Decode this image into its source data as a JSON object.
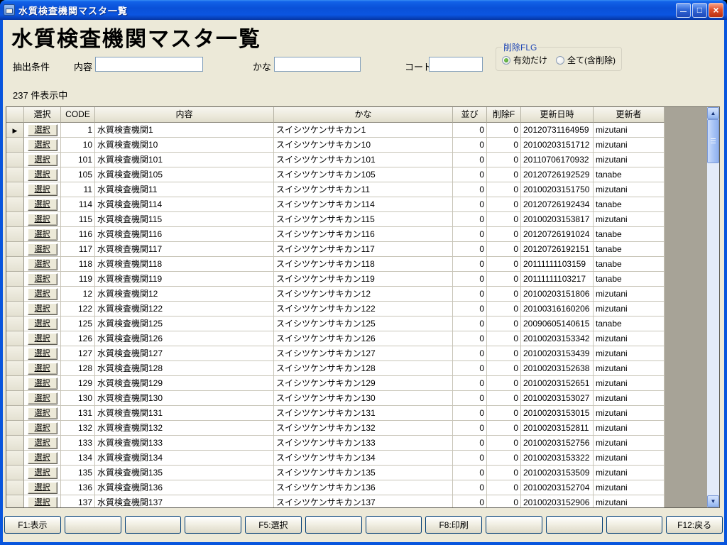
{
  "window": {
    "title": "水質検査機関マスタ一覧",
    "minimize_glyph": "—",
    "maximize_glyph": "□",
    "close_glyph": "×"
  },
  "page": {
    "heading": "水質検査機関マスタ一覧",
    "count_text": "237 件表示中"
  },
  "filters": {
    "section_label": "抽出条件",
    "naiyo": {
      "label": "内容",
      "value": ""
    },
    "kana": {
      "label": "かな",
      "value": ""
    },
    "code": {
      "label": "コード",
      "value": ""
    },
    "delete_flg": {
      "label": "削除FLG",
      "option_active": "有効だけ",
      "option_all": "全て(含削除)",
      "selected": "有効だけ"
    }
  },
  "grid": {
    "columns": {
      "selector": "",
      "select": "選択",
      "code": "CODE",
      "naiyo": "内容",
      "kana": "かな",
      "narabi": "並び",
      "sakujo_f": "削除F",
      "koshin_nichiji": "更新日時",
      "koshin_sha": "更新者"
    },
    "select_button_label": "選択",
    "current_row_marker": "▶",
    "rows": [
      {
        "code": "1",
        "naiyo": "水質検査機関1",
        "kana": "スイシツケンサキカン1",
        "narabi": "0",
        "sakujo_f": "0",
        "koshin_nichiji": "20120731164959",
        "koshin_sha": "mizutani"
      },
      {
        "code": "10",
        "naiyo": "水質検査機関10",
        "kana": "スイシツケンサキカン10",
        "narabi": "0",
        "sakujo_f": "0",
        "koshin_nichiji": "20100203151712",
        "koshin_sha": "mizutani"
      },
      {
        "code": "101",
        "naiyo": "水質検査機関101",
        "kana": "スイシツケンサキカン101",
        "narabi": "0",
        "sakujo_f": "0",
        "koshin_nichiji": "20110706170932",
        "koshin_sha": "mizutani"
      },
      {
        "code": "105",
        "naiyo": "水質検査機関105",
        "kana": "スイシツケンサキカン105",
        "narabi": "0",
        "sakujo_f": "0",
        "koshin_nichiji": "20120726192529",
        "koshin_sha": "tanabe"
      },
      {
        "code": "11",
        "naiyo": "水質検査機関11",
        "kana": "スイシツケンサキカン11",
        "narabi": "0",
        "sakujo_f": "0",
        "koshin_nichiji": "20100203151750",
        "koshin_sha": "mizutani"
      },
      {
        "code": "114",
        "naiyo": "水質検査機関114",
        "kana": "スイシツケンサキカン114",
        "narabi": "0",
        "sakujo_f": "0",
        "koshin_nichiji": "20120726192434",
        "koshin_sha": "tanabe"
      },
      {
        "code": "115",
        "naiyo": "水質検査機関115",
        "kana": "スイシツケンサキカン115",
        "narabi": "0",
        "sakujo_f": "0",
        "koshin_nichiji": "20100203153817",
        "koshin_sha": "mizutani"
      },
      {
        "code": "116",
        "naiyo": "水質検査機関116",
        "kana": "スイシツケンサキカン116",
        "narabi": "0",
        "sakujo_f": "0",
        "koshin_nichiji": "20120726191024",
        "koshin_sha": "tanabe"
      },
      {
        "code": "117",
        "naiyo": "水質検査機関117",
        "kana": "スイシツケンサキカン117",
        "narabi": "0",
        "sakujo_f": "0",
        "koshin_nichiji": "20120726192151",
        "koshin_sha": "tanabe"
      },
      {
        "code": "118",
        "naiyo": "水質検査機関118",
        "kana": "スイシツケンサキカン118",
        "narabi": "0",
        "sakujo_f": "0",
        "koshin_nichiji": "20111111103159",
        "koshin_sha": "tanabe"
      },
      {
        "code": "119",
        "naiyo": "水質検査機関119",
        "kana": "スイシツケンサキカン119",
        "narabi": "0",
        "sakujo_f": "0",
        "koshin_nichiji": "20111111103217",
        "koshin_sha": "tanabe"
      },
      {
        "code": "12",
        "naiyo": "水質検査機関12",
        "kana": "スイシツケンサキカン12",
        "narabi": "0",
        "sakujo_f": "0",
        "koshin_nichiji": "20100203151806",
        "koshin_sha": "mizutani"
      },
      {
        "code": "122",
        "naiyo": "水質検査機関122",
        "kana": "スイシツケンサキカン122",
        "narabi": "0",
        "sakujo_f": "0",
        "koshin_nichiji": "20100316160206",
        "koshin_sha": "mizutani"
      },
      {
        "code": "125",
        "naiyo": "水質検査機関125",
        "kana": "スイシツケンサキカン125",
        "narabi": "0",
        "sakujo_f": "0",
        "koshin_nichiji": "20090605140615",
        "koshin_sha": "tanabe"
      },
      {
        "code": "126",
        "naiyo": "水質検査機関126",
        "kana": "スイシツケンサキカン126",
        "narabi": "0",
        "sakujo_f": "0",
        "koshin_nichiji": "20100203153342",
        "koshin_sha": "mizutani"
      },
      {
        "code": "127",
        "naiyo": "水質検査機関127",
        "kana": "スイシツケンサキカン127",
        "narabi": "0",
        "sakujo_f": "0",
        "koshin_nichiji": "20100203153439",
        "koshin_sha": "mizutani"
      },
      {
        "code": "128",
        "naiyo": "水質検査機関128",
        "kana": "スイシツケンサキカン128",
        "narabi": "0",
        "sakujo_f": "0",
        "koshin_nichiji": "20100203152638",
        "koshin_sha": "mizutani"
      },
      {
        "code": "129",
        "naiyo": "水質検査機関129",
        "kana": "スイシツケンサキカン129",
        "narabi": "0",
        "sakujo_f": "0",
        "koshin_nichiji": "20100203152651",
        "koshin_sha": "mizutani"
      },
      {
        "code": "130",
        "naiyo": "水質検査機関130",
        "kana": "スイシツケンサキカン130",
        "narabi": "0",
        "sakujo_f": "0",
        "koshin_nichiji": "20100203153027",
        "koshin_sha": "mizutani"
      },
      {
        "code": "131",
        "naiyo": "水質検査機関131",
        "kana": "スイシツケンサキカン131",
        "narabi": "0",
        "sakujo_f": "0",
        "koshin_nichiji": "20100203153015",
        "koshin_sha": "mizutani"
      },
      {
        "code": "132",
        "naiyo": "水質検査機関132",
        "kana": "スイシツケンサキカン132",
        "narabi": "0",
        "sakujo_f": "0",
        "koshin_nichiji": "20100203152811",
        "koshin_sha": "mizutani"
      },
      {
        "code": "133",
        "naiyo": "水質検査機関133",
        "kana": "スイシツケンサキカン133",
        "narabi": "0",
        "sakujo_f": "0",
        "koshin_nichiji": "20100203152756",
        "koshin_sha": "mizutani"
      },
      {
        "code": "134",
        "naiyo": "水質検査機関134",
        "kana": "スイシツケンサキカン134",
        "narabi": "0",
        "sakujo_f": "0",
        "koshin_nichiji": "20100203153322",
        "koshin_sha": "mizutani"
      },
      {
        "code": "135",
        "naiyo": "水質検査機関135",
        "kana": "スイシツケンサキカン135",
        "narabi": "0",
        "sakujo_f": "0",
        "koshin_nichiji": "20100203153509",
        "koshin_sha": "mizutani"
      },
      {
        "code": "136",
        "naiyo": "水質検査機関136",
        "kana": "スイシツケンサキカン136",
        "narabi": "0",
        "sakujo_f": "0",
        "koshin_nichiji": "20100203152704",
        "koshin_sha": "mizutani"
      },
      {
        "code": "137",
        "naiyo": "水質検査機関137",
        "kana": "スイシツケンサキカン137",
        "narabi": "0",
        "sakujo_f": "0",
        "koshin_nichiji": "20100203152906",
        "koshin_sha": "mizutani"
      }
    ]
  },
  "function_bar": {
    "buttons": [
      "F1:表示",
      "",
      "",
      "",
      "F5:選択",
      "",
      "",
      "F8:印刷",
      "",
      "",
      "",
      "F12:戻る"
    ]
  }
}
